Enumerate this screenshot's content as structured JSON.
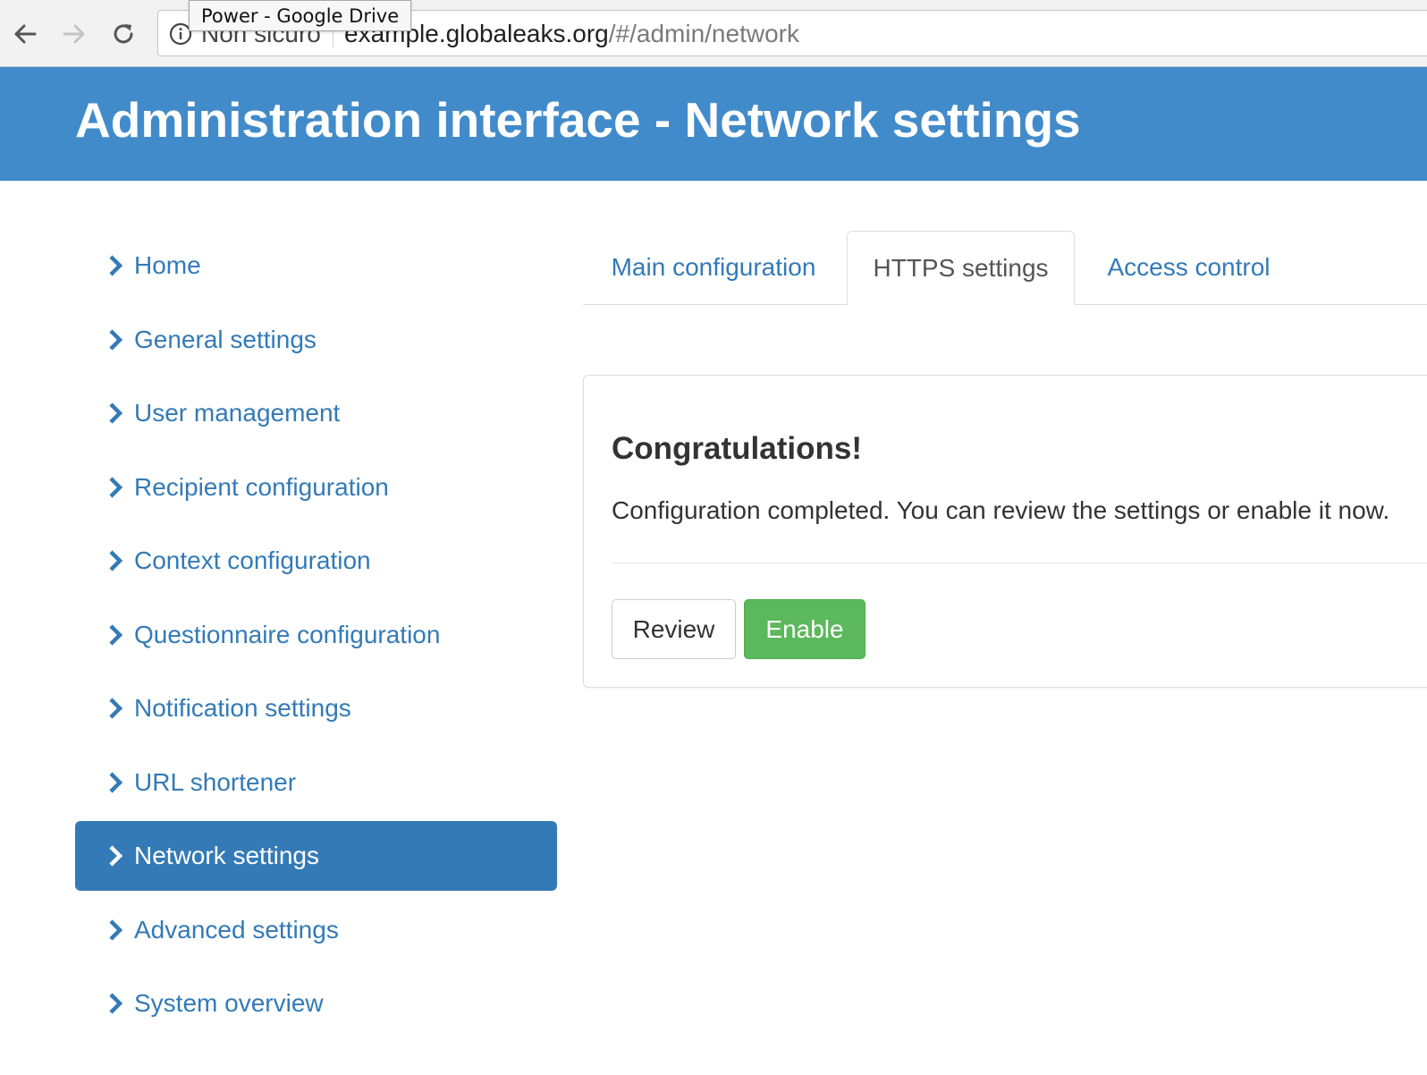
{
  "browser": {
    "tooltip": "Power - Google Drive",
    "security_label": "Non sicuro",
    "url_host": "example.globaleaks.org",
    "url_path": "/#/admin/network"
  },
  "header": {
    "title": "Administration interface - Network settings"
  },
  "sidebar": {
    "items": [
      {
        "label": "Home"
      },
      {
        "label": "General settings"
      },
      {
        "label": "User management"
      },
      {
        "label": "Recipient configuration"
      },
      {
        "label": "Context configuration"
      },
      {
        "label": "Questionnaire configuration"
      },
      {
        "label": "Notification settings"
      },
      {
        "label": "URL shortener"
      },
      {
        "label": "Network settings",
        "active": true
      },
      {
        "label": "Advanced settings"
      },
      {
        "label": "System overview"
      }
    ]
  },
  "tabs": [
    {
      "label": "Main configuration"
    },
    {
      "label": "HTTPS settings",
      "active": true
    },
    {
      "label": "Access control"
    }
  ],
  "panel": {
    "heading": "Congratulations!",
    "message": "Configuration completed. You can review the settings or enable it now.",
    "review_label": "Review",
    "enable_label": "Enable"
  },
  "colors": {
    "header_bg": "#428bca",
    "link": "#337ab7",
    "active_bg": "#337ab7",
    "success": "#5cb85c"
  },
  "icons": {
    "back": "arrow-left-icon",
    "forward": "arrow-right-icon",
    "reload": "reload-icon",
    "info": "info-icon",
    "sidebar_item": "chevron-right-icon"
  }
}
